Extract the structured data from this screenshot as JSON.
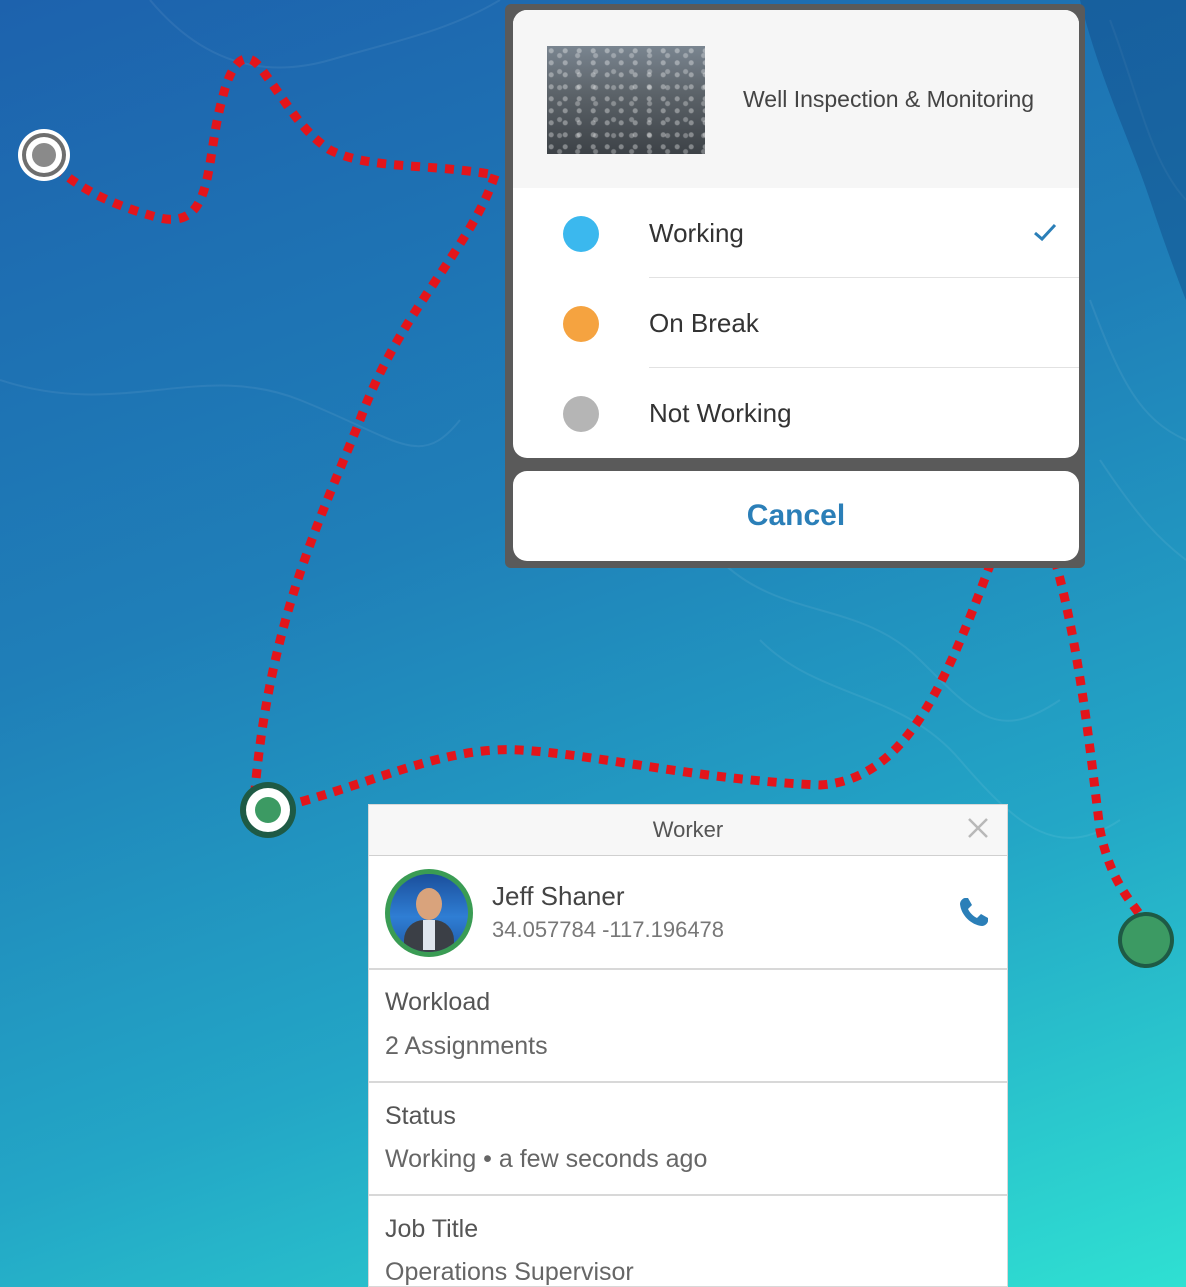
{
  "status_sheet": {
    "title": "Well Inspection & Monitoring",
    "options": [
      {
        "label": "Working",
        "color": "#3bb8ee",
        "selected": true
      },
      {
        "label": "On Break",
        "color": "#f5a340",
        "selected": false
      },
      {
        "label": "Not Working",
        "color": "#b5b5b5",
        "selected": false
      }
    ],
    "cancel_label": "Cancel"
  },
  "worker_panel": {
    "header": "Worker",
    "name": "Jeff Shaner",
    "coordinates": "34.057784 -117.196478",
    "fields": [
      {
        "label": "Workload",
        "value": "2 Assignments"
      },
      {
        "label": "Status",
        "value": "Working • a few seconds ago"
      },
      {
        "label": "Job Title",
        "value": "Operations Supervisor"
      }
    ]
  },
  "map": {
    "route_color": "#e3151b",
    "marker_colors": {
      "inactive": "#8a8a8a",
      "active": "#3c9a63"
    }
  }
}
